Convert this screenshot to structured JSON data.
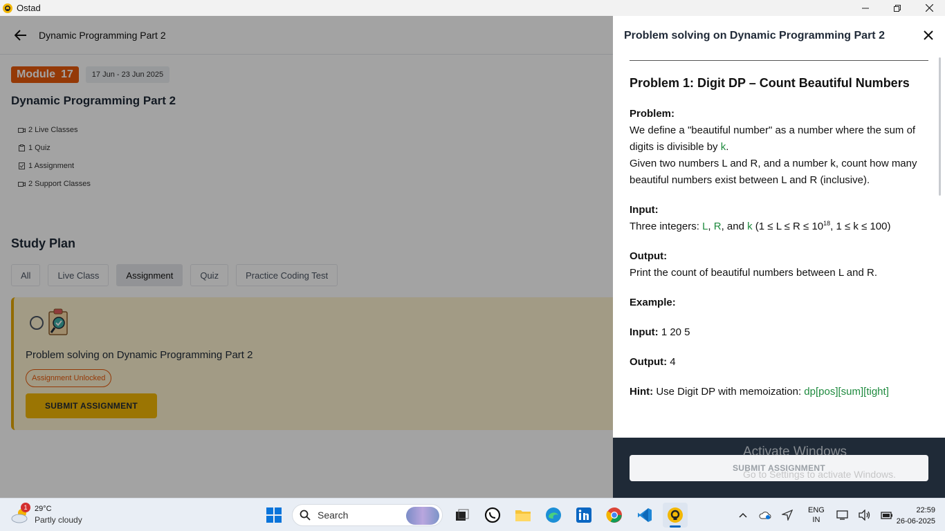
{
  "window": {
    "title": "Ostad",
    "controls": [
      "minimize",
      "restore",
      "close"
    ]
  },
  "topbar": {
    "title": "Dynamic Programming Part 2"
  },
  "module": {
    "badge_label": "Module",
    "badge_number": "17",
    "date_range": "17 Jun - 23 Jun 2025",
    "title": "Dynamic Programming Part 2",
    "items": [
      {
        "icon": "video-icon",
        "label": "2 Live Classes"
      },
      {
        "icon": "clipboard-icon",
        "label": "1 Quiz"
      },
      {
        "icon": "assignment-icon",
        "label": "1 Assignment"
      },
      {
        "icon": "video-icon",
        "label": "2 Support Classes"
      }
    ]
  },
  "study_plan": {
    "title": "Study Plan",
    "filters": [
      "All",
      "Live Class",
      "Assignment",
      "Quiz",
      "Practice Coding Test"
    ],
    "active_filter": "Assignment",
    "card": {
      "title": "Problem solving on Dynamic Programming Part 2",
      "status": "Assignment Unlocked",
      "button": "SUBMIT ASSIGNMENT"
    }
  },
  "drawer": {
    "title": "Problem solving on Dynamic Programming Part 2",
    "problem_title": "Problem 1: Digit DP – Count Beautiful Numbers",
    "problem_label": "Problem:",
    "problem_line1_pre": "We define a \"beautiful number\" as a number where the sum of digits is divisible by ",
    "problem_line1_var": "k",
    "problem_line1_post": ".",
    "problem_line2": "Given two numbers L and R, and a number k, count how many beautiful numbers exist between L and R (inclusive).",
    "input_label": "Input:",
    "input_pre": "Three integers: ",
    "input_var_l": "L",
    "input_sep1": ", ",
    "input_var_r": "R",
    "input_sep2": ", and ",
    "input_var_k": "k",
    "input_constraint_pre": " (1 ≤ L ≤ R ≤ 10",
    "input_constraint_exp": "18",
    "input_constraint_post": ", 1 ≤ k ≤ 100)",
    "output_label": "Output:",
    "output_text": "Print the count of beautiful numbers between L and R.",
    "example_label": "Example:",
    "example_input_label": "Input:",
    "example_input_value": " 1 20 5",
    "example_output_label": "Output:",
    "example_output_value": " 4",
    "hint_label": "Hint:",
    "hint_text": " Use Digit DP with memoization: ",
    "hint_code": "dp[pos][sum][tight]",
    "footer_button": "SUBMIT ASSIGNMENT",
    "watermark_title": "Activate Windows",
    "watermark_sub": "Go to Settings to activate Windows."
  },
  "taskbar": {
    "weather_badge": "1",
    "weather_temp": "29°C",
    "weather_desc": "Partly cloudy",
    "search_placeholder": "Search",
    "apps": [
      "start-icon",
      "task-view-icon",
      "whatsapp-icon",
      "file-explorer-icon",
      "edge-icon",
      "linkedin-icon",
      "chrome-icon",
      "vscode-icon",
      "ostad-icon"
    ],
    "lang_top": "ENG",
    "lang_bottom": "IN",
    "time": "22:59",
    "date": "26-06-2025"
  }
}
